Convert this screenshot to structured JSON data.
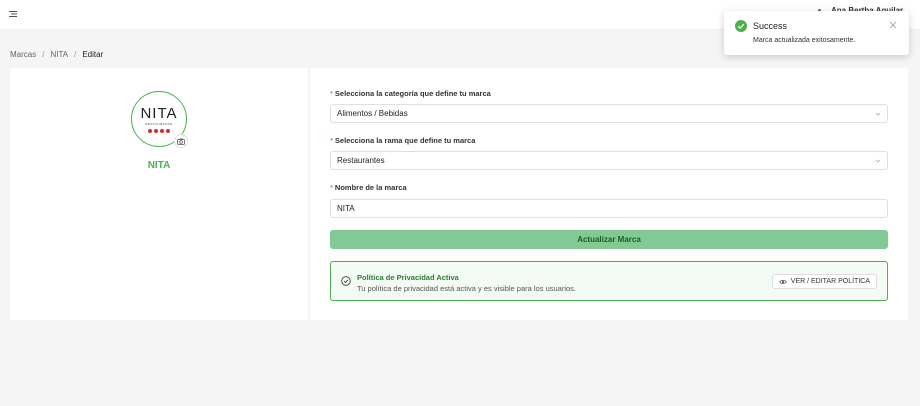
{
  "header": {
    "user_name": "Ana Bertha Aguilar"
  },
  "breadcrumb": [
    {
      "label": "Marcas"
    },
    {
      "label": "NITA"
    },
    {
      "label": "Editar"
    }
  ],
  "brand_card": {
    "logo_text": "NITA",
    "logo_subtext": "RESTAURANTE",
    "brand_name": "NITA"
  },
  "form": {
    "category_label": "Selecciona la categoría que define tu marca",
    "category_value": "Alimentos / Bebidas",
    "branch_label": "Selecciona la rama que define tu marca",
    "branch_value": "Restaurantes",
    "name_label": "Nombre de la marca",
    "name_value": "NITA",
    "submit_label": "Actualizar Marca"
  },
  "policy": {
    "title": "Política de Privacidad Activa",
    "description": "Tu política de privacidad está activa y es visible para los usuarios.",
    "button_label": "VER / EDITAR POLÍTICA"
  },
  "toast": {
    "title": "Success",
    "message": "Marca actualizada exitosamente."
  },
  "colors": {
    "accent": "#4caf50",
    "submit_bg": "#81c995",
    "required": "#e53935"
  },
  "icons": [
    "menu-icon",
    "camera-icon",
    "chevron-down-icon",
    "check-circle-icon",
    "eye-icon",
    "close-icon"
  ]
}
